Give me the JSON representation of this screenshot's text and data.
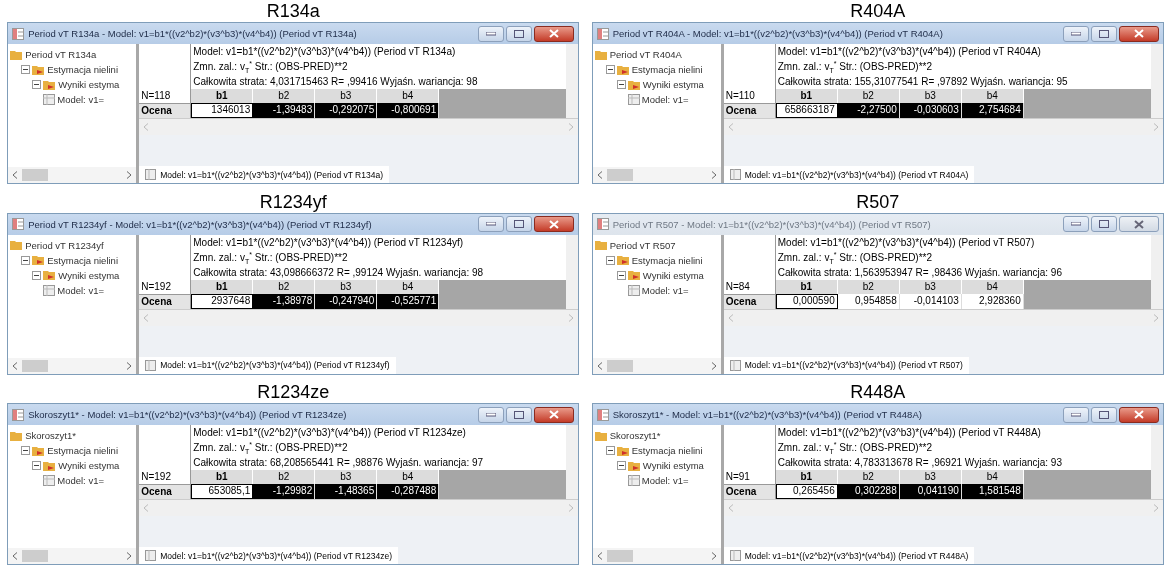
{
  "panels": [
    {
      "caption": "R134a",
      "window": {
        "title": "Period vT R134a - Model: v1=b1*((v2^b2)*(v3^b3)*(v4^b4)) (Period vT R134a)",
        "active": true
      },
      "tree": {
        "label": "Period vT R134a",
        "children": [
          {
            "label": "Estymacja nielini",
            "expanded": true,
            "children": [
              {
                "label": "Wyniki estyma",
                "expanded": true,
                "children": [
                  {
                    "label": "Model: v1="
                  }
                ]
              }
            ]
          }
        ]
      },
      "results": {
        "model_line": "Model: v1=b1*((v2^b2)*(v3^b3)*(v4^b4)) (Period vT R134a)",
        "dependent": {
          "text": "Zmn. zal.: v",
          "subscript": "T",
          "superscript": "*",
          "rest": " Str.: (OBS-PRED)**2"
        },
        "loss_line": "Całkowita strata: 4,031715463 R= ,99416 Wyjaśn. wariancja: 98",
        "n": "N=118",
        "columns": [
          "b1",
          "b2",
          "b3",
          "b4"
        ],
        "row_label": "Ocena",
        "cells": [
          {
            "value": "1346013",
            "focused": true,
            "selected": false
          },
          {
            "value": "-1,39483",
            "focused": false,
            "selected": true
          },
          {
            "value": "-0,292075",
            "focused": false,
            "selected": true
          },
          {
            "value": "-0,800691",
            "focused": false,
            "selected": true
          }
        ]
      },
      "tab": "Model: v1=b1*((v2^b2)*(v3^b3)*(v4^b4)) (Period vT R134a)"
    },
    {
      "caption": "R404A",
      "window": {
        "title": "Period vT R404A - Model: v1=b1*((v2^b2)*(v3^b3)*(v4^b4)) (Period vT R404A)",
        "active": true
      },
      "tree": {
        "label": "Period vT R404A",
        "children": [
          {
            "label": "Estymacja nielini",
            "expanded": true,
            "children": [
              {
                "label": "Wyniki estyma",
                "expanded": true,
                "children": [
                  {
                    "label": "Model: v1="
                  }
                ]
              }
            ]
          }
        ]
      },
      "results": {
        "model_line": "Model: v1=b1*((v2^b2)*(v3^b3)*(v4^b4)) (Period vT R404A)",
        "dependent": {
          "text": "Zmn. zal.: v",
          "subscript": "T",
          "superscript": "*",
          "rest": " Str.: (OBS-PRED)**2"
        },
        "loss_line": "Całkowita strata: 155,31077541 R= ,97892 Wyjaśn. wariancja: 95",
        "n": "N=110",
        "columns": [
          "b1",
          "b2",
          "b3",
          "b4"
        ],
        "row_label": "Ocena",
        "cells": [
          {
            "value": "658663187",
            "focused": true,
            "selected": false
          },
          {
            "value": "-2,27500",
            "focused": false,
            "selected": true
          },
          {
            "value": "-0,030603",
            "focused": false,
            "selected": true
          },
          {
            "value": "2,754684",
            "focused": false,
            "selected": true
          }
        ]
      },
      "tab": "Model: v1=b1*((v2^b2)*(v3^b3)*(v4^b4)) (Period vT R404A)"
    },
    {
      "caption": "R1234yf",
      "window": {
        "title": "Period vT R1234yf - Model: v1=b1*((v2^b2)*(v3^b3)*(v4^b4)) (Period vT R1234yf)",
        "active": true
      },
      "tree": {
        "label": "Period vT R1234yf",
        "children": [
          {
            "label": "Estymacja nielini",
            "expanded": true,
            "children": [
              {
                "label": "Wyniki estyma",
                "expanded": true,
                "children": [
                  {
                    "label": "Model: v1="
                  }
                ]
              }
            ]
          }
        ]
      },
      "results": {
        "model_line": "Model: v1=b1*((v2^b2)*(v3^b3)*(v4^b4)) (Period vT R1234yf)",
        "dependent": {
          "text": "Zmn. zal.: v",
          "subscript": "T",
          "superscript": "*",
          "rest": " Str.: (OBS-PRED)**2"
        },
        "loss_line": "Całkowita strata: 43,098666372 R= ,99124 Wyjaśn. wariancja: 98",
        "n": "N=192",
        "columns": [
          "b1",
          "b2",
          "b3",
          "b4"
        ],
        "row_label": "Ocena",
        "cells": [
          {
            "value": "2937648",
            "focused": true,
            "selected": false
          },
          {
            "value": "-1,38978",
            "focused": false,
            "selected": true
          },
          {
            "value": "-0,247940",
            "focused": false,
            "selected": true
          },
          {
            "value": "-0,525771",
            "focused": false,
            "selected": true
          }
        ]
      },
      "tab": "Model: v1=b1*((v2^b2)*(v3^b3)*(v4^b4)) (Period vT R1234yf)"
    },
    {
      "caption": "R507",
      "window": {
        "title": "Period vT R507 - Model: v1=b1*((v2^b2)*(v3^b3)*(v4^b4)) (Period vT R507)",
        "active": false
      },
      "tree": {
        "label": "Period vT R507",
        "children": [
          {
            "label": "Estymacja nielini",
            "expanded": true,
            "children": [
              {
                "label": "Wyniki estyma",
                "expanded": true,
                "children": [
                  {
                    "label": "Model: v1="
                  }
                ]
              }
            ]
          }
        ]
      },
      "results": {
        "model_line": "Model: v1=b1*((v2^b2)*(v3^b3)*(v4^b4)) (Period vT R507)",
        "dependent": {
          "text": "Zmn. zal.: v",
          "subscript": "T",
          "superscript": "*",
          "rest": " Str.: (OBS-PRED)**2"
        },
        "loss_line": "Całkowita strata: 1,563953947 R= ,98436 Wyjaśn. wariancja: 96",
        "n": "N=84",
        "columns": [
          "b1",
          "b2",
          "b3",
          "b4"
        ],
        "row_label": "Ocena",
        "cells": [
          {
            "value": "0,000590",
            "focused": true,
            "selected": false
          },
          {
            "value": "0,954858",
            "focused": false,
            "selected": false
          },
          {
            "value": "-0,014103",
            "focused": false,
            "selected": false
          },
          {
            "value": "2,928360",
            "focused": false,
            "selected": false
          }
        ]
      },
      "tab": "Model: v1=b1*((v2^b2)*(v3^b3)*(v4^b4)) (Period vT R507)"
    },
    {
      "caption": "R1234ze",
      "window": {
        "title": "Skoroszyt1* - Model: v1=b1*((v2^b2)*(v3^b3)*(v4^b4)) (Period vT R1234ze)",
        "active": true
      },
      "tree": {
        "label": "Skoroszyt1*",
        "children": [
          {
            "label": "Estymacja nielini",
            "expanded": true,
            "children": [
              {
                "label": "Wyniki estyma",
                "expanded": true,
                "children": [
                  {
                    "label": "Model: v1="
                  }
                ]
              }
            ]
          }
        ]
      },
      "results": {
        "model_line": "Model: v1=b1*((v2^b2)*(v3^b3)*(v4^b4)) (Period vT R1234ze)",
        "dependent": {
          "text": "Zmn. zal.: v",
          "subscript": "T",
          "superscript": "*",
          "rest": " Str.: (OBS-PRED)**2"
        },
        "loss_line": "Całkowita strata: 68,208565441 R= ,98876 Wyjaśn. wariancja: 97",
        "n": "N=192",
        "columns": [
          "b1",
          "b2",
          "b3",
          "b4"
        ],
        "row_label": "Ocena",
        "cells": [
          {
            "value": "653085,1",
            "focused": true,
            "selected": false
          },
          {
            "value": "-1,29982",
            "focused": false,
            "selected": true
          },
          {
            "value": "-1,48365",
            "focused": false,
            "selected": true
          },
          {
            "value": "-0,287488",
            "focused": false,
            "selected": true
          }
        ]
      },
      "tab": "Model: v1=b1*((v2^b2)*(v3^b3)*(v4^b4)) (Period vT R1234ze)"
    },
    {
      "caption": "R448A",
      "window": {
        "title": "Skoroszyt1* - Model: v1=b1*((v2^b2)*(v3^b3)*(v4^b4)) (Period vT R448A)",
        "active": true
      },
      "tree": {
        "label": "Skoroszyt1*",
        "children": [
          {
            "label": "Estymacja nielini",
            "expanded": true,
            "children": [
              {
                "label": "Wyniki estyma",
                "expanded": true,
                "children": [
                  {
                    "label": "Model: v1="
                  }
                ]
              }
            ]
          }
        ]
      },
      "results": {
        "model_line": "Model: v1=b1*((v2^b2)*(v3^b3)*(v4^b4)) (Period vT R448A)",
        "dependent": {
          "text": "Zmn. zal.: v",
          "subscript": "T",
          "superscript": "*",
          "rest": " Str.: (OBS-PRED)**2"
        },
        "loss_line": "Całkowita strata: 4,783313678 R= ,96921 Wyjaśn. wariancja: 93",
        "n": "N=91",
        "columns": [
          "b1",
          "b2",
          "b3",
          "b4"
        ],
        "row_label": "Ocena",
        "cells": [
          {
            "value": "0,265456",
            "focused": true,
            "selected": false
          },
          {
            "value": "0,302288",
            "focused": false,
            "selected": true
          },
          {
            "value": "0,041190",
            "focused": false,
            "selected": true
          },
          {
            "value": "1,581548",
            "focused": false,
            "selected": true
          }
        ]
      },
      "tab": "Model: v1=b1*((v2^b2)*(v3^b3)*(v4^b4)) (Period vT R448A)"
    }
  ]
}
